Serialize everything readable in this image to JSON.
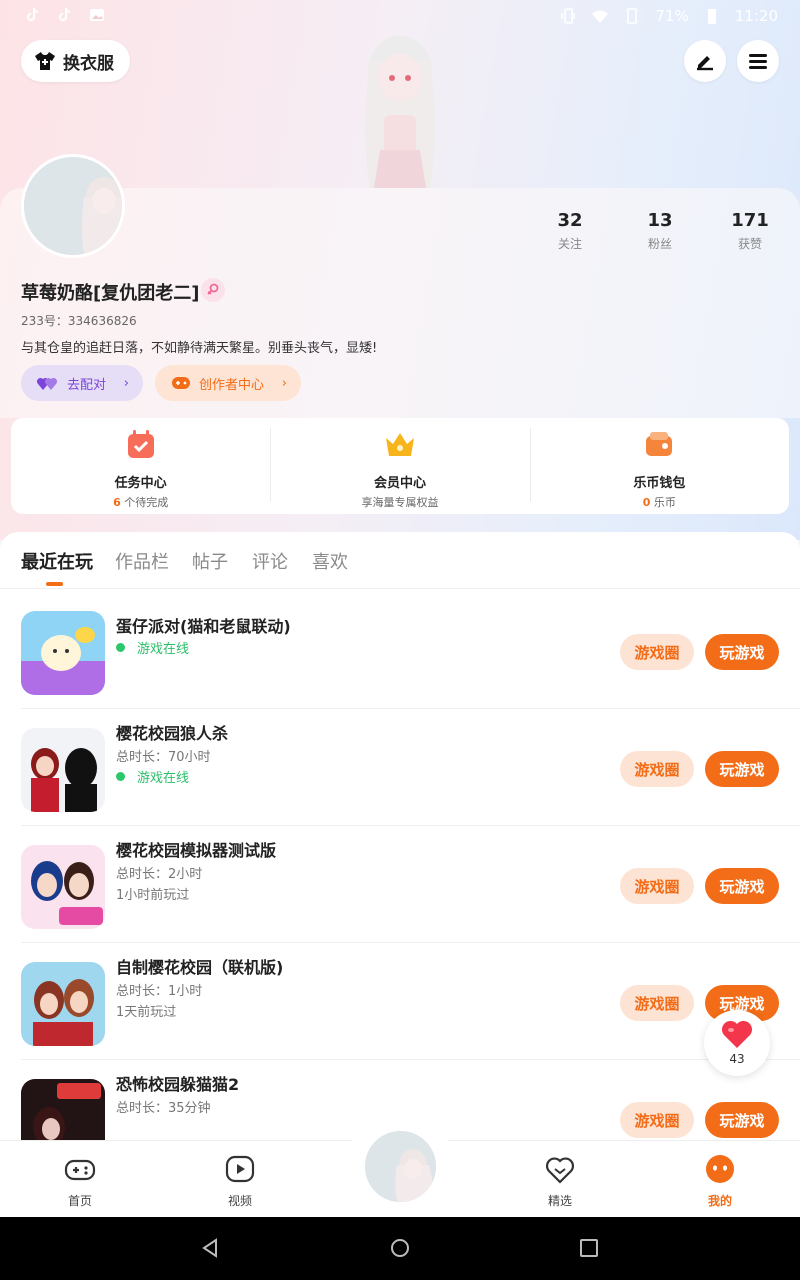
{
  "status_bar": {
    "left_icons": [
      "tiktok-icon",
      "tiktok-icon",
      "image-icon"
    ],
    "battery": "71%",
    "time": "11:20"
  },
  "header": {
    "dress_button": "换衣服",
    "edit_icon": "pencil-icon",
    "menu_icon": "hamburger-menu-icon"
  },
  "profile": {
    "stats": [
      {
        "value": "32",
        "label": "关注"
      },
      {
        "value": "13",
        "label": "粉丝"
      },
      {
        "value": "171",
        "label": "获赞"
      }
    ],
    "nickname": "草莓奶酪[复仇团老二]",
    "uid": "233号：334636826",
    "bio": "与其仓皇的追赶日落，不如静待满天繁星。别垂头丧气，显矮!",
    "match_button": "去配对",
    "creator_button": "创作者中心"
  },
  "quick_actions": [
    {
      "title": "任务中心",
      "count": "6",
      "sub": "个待完成",
      "icon": "calendar-check-icon"
    },
    {
      "title": "会员中心",
      "count": "",
      "sub": "享海量专属权益",
      "icon": "crown-icon"
    },
    {
      "title": "乐币钱包",
      "count": "0",
      "sub": "乐币",
      "icon": "wallet-icon"
    }
  ],
  "tabs": [
    "最近在玩",
    "作品栏",
    "帖子",
    "评论",
    "喜欢"
  ],
  "games": [
    {
      "name": "蛋仔派对(猫和老鼠联动)",
      "duration": "",
      "last": "",
      "online": "游戏在线"
    },
    {
      "name": "樱花校园狼人杀",
      "duration": "总时长：70小时",
      "last": "",
      "online": "游戏在线"
    },
    {
      "name": "樱花校园模拟器测试版",
      "duration": "总时长：2小时",
      "last": "1小时前玩过",
      "online": ""
    },
    {
      "name": "自制樱花校园（联机版)",
      "duration": "总时长：1小时",
      "last": "1天前玩过",
      "online": ""
    },
    {
      "name": "恐怖校园躲猫猫2",
      "duration": "总时长：35分钟",
      "last": "",
      "online": ""
    }
  ],
  "game_buttons": {
    "circle": "游戏圈",
    "play": "玩游戏"
  },
  "like_bubble": {
    "count": "43",
    "icon": "heart-icon"
  },
  "bottom_nav": [
    {
      "label": "首页",
      "icon": "gamepad-icon"
    },
    {
      "label": "视频",
      "icon": "play-video-icon"
    },
    {
      "label": "精选",
      "icon": "heart-chat-icon"
    },
    {
      "label": "我的",
      "icon": "smiley-face-icon"
    }
  ],
  "colors": {
    "accent": "#f36c17",
    "online": "#2bbf6a",
    "match": "#7b45d9"
  }
}
